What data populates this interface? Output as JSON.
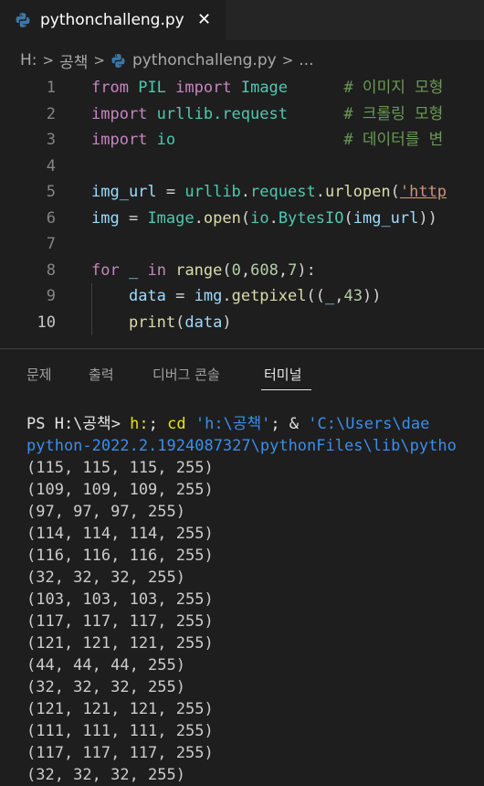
{
  "tab": {
    "title": "pythonchalleng.py",
    "close_glyph": "✕",
    "icon": "python-icon"
  },
  "breadcrumb": {
    "drive": "H:",
    "folder": "공책",
    "file": "pythonchalleng.py",
    "more": "...",
    "separator": ">"
  },
  "editor": {
    "lines": [
      {
        "n": "1",
        "tokens": [
          [
            "kw",
            "from"
          ],
          [
            "op",
            " "
          ],
          [
            "mod",
            "PIL"
          ],
          [
            "op",
            " "
          ],
          [
            "kw",
            "import"
          ],
          [
            "op",
            " "
          ],
          [
            "mod",
            "Image"
          ],
          [
            "op",
            "      "
          ],
          [
            "com",
            "# 이미지 모형"
          ]
        ]
      },
      {
        "n": "2",
        "tokens": [
          [
            "kw",
            "import"
          ],
          [
            "op",
            " "
          ],
          [
            "mod",
            "urllib.request"
          ],
          [
            "op",
            "      "
          ],
          [
            "com",
            "# 크롤링 모형"
          ]
        ]
      },
      {
        "n": "3",
        "tokens": [
          [
            "kw",
            "import"
          ],
          [
            "op",
            " "
          ],
          [
            "mod",
            "io"
          ],
          [
            "op",
            "                  "
          ],
          [
            "com",
            "# 데이터를 변"
          ]
        ]
      },
      {
        "n": "4",
        "tokens": []
      },
      {
        "n": "5",
        "tokens": [
          [
            "var",
            "img_url"
          ],
          [
            "op",
            " = "
          ],
          [
            "mod",
            "urllib"
          ],
          [
            "op",
            "."
          ],
          [
            "mod",
            "request"
          ],
          [
            "op",
            "."
          ],
          [
            "fn",
            "urlopen"
          ],
          [
            "op",
            "("
          ],
          [
            "str",
            "'http"
          ]
        ]
      },
      {
        "n": "6",
        "tokens": [
          [
            "var",
            "img"
          ],
          [
            "op",
            " = "
          ],
          [
            "mod",
            "Image"
          ],
          [
            "op",
            "."
          ],
          [
            "fn",
            "open"
          ],
          [
            "op",
            "("
          ],
          [
            "mod",
            "io"
          ],
          [
            "op",
            "."
          ],
          [
            "mod",
            "BytesIO"
          ],
          [
            "op",
            "("
          ],
          [
            "var",
            "img_url"
          ],
          [
            "op",
            "))"
          ]
        ]
      },
      {
        "n": "7",
        "tokens": []
      },
      {
        "n": "8",
        "tokens": [
          [
            "kw",
            "for"
          ],
          [
            "op",
            " "
          ],
          [
            "var",
            "_"
          ],
          [
            "op",
            " "
          ],
          [
            "kw",
            "in"
          ],
          [
            "op",
            " "
          ],
          [
            "fn",
            "range"
          ],
          [
            "op",
            "("
          ],
          [
            "num",
            "0"
          ],
          [
            "op",
            ","
          ],
          [
            "num",
            "608"
          ],
          [
            "op",
            ","
          ],
          [
            "num",
            "7"
          ],
          [
            "op",
            "):"
          ]
        ]
      },
      {
        "n": "9",
        "tokens": [
          [
            "op",
            "    "
          ],
          [
            "var",
            "data"
          ],
          [
            "op",
            " = "
          ],
          [
            "var",
            "img"
          ],
          [
            "op",
            "."
          ],
          [
            "fn",
            "getpixel"
          ],
          [
            "op",
            "(("
          ],
          [
            "var",
            "_"
          ],
          [
            "op",
            ","
          ],
          [
            "num",
            "43"
          ],
          [
            "op",
            "))"
          ]
        ]
      },
      {
        "n": "10",
        "tokens": [
          [
            "op",
            "    "
          ],
          [
            "fn",
            "print"
          ],
          [
            "op",
            "("
          ],
          [
            "var",
            "data"
          ],
          [
            "op",
            ")"
          ]
        ]
      }
    ]
  },
  "panel": {
    "tabs": [
      "문제",
      "출력",
      "디버그 콘솔",
      "터미널"
    ],
    "active_tab": "터미널"
  },
  "terminal": {
    "prompt": "PS H:\\공책> ",
    "cmd_parts": [
      [
        "t-yellow",
        "h:"
      ],
      [
        "t-white",
        "; "
      ],
      [
        "t-yellow",
        "cd "
      ],
      [
        "t-blue",
        "'h:\\공책'"
      ],
      [
        "t-white",
        "; & "
      ],
      [
        "t-blue",
        "'C:\\Users\\dae"
      ]
    ],
    "cmd_line2": "python-2022.2.1924087327\\pythonFiles\\lib\\pytho",
    "output": [
      "(115, 115, 115, 255)",
      "(109, 109, 109, 255)",
      "(97, 97, 97, 255)",
      "(114, 114, 114, 255)",
      "(116, 116, 116, 255)",
      "(32, 32, 32, 255)",
      "(103, 103, 103, 255)",
      "(117, 117, 117, 255)",
      "(121, 121, 121, 255)",
      "(44, 44, 44, 255)",
      "(32, 32, 32, 255)",
      "(121, 121, 121, 255)",
      "(111, 111, 111, 255)",
      "(117, 117, 117, 255)",
      "(32, 32, 32, 255)"
    ]
  }
}
